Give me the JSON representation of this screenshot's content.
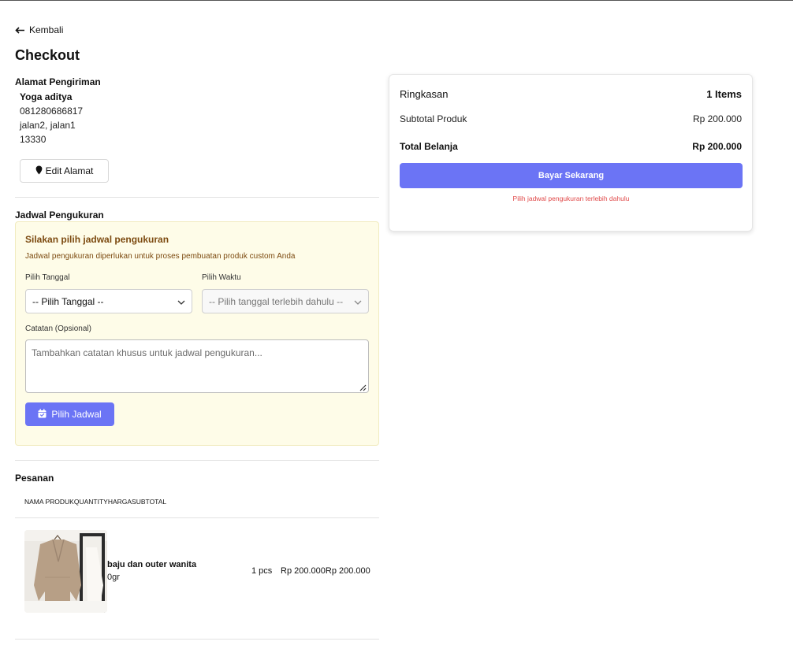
{
  "nav": {
    "back_label": "Kembali",
    "page_title": "Checkout"
  },
  "address": {
    "section_label": "Alamat Pengiriman",
    "name": "Yoga aditya",
    "phone": "081280686817",
    "street": "jalan2, jalan1",
    "postal_code": "13330",
    "edit_label": "Edit Alamat"
  },
  "schedule": {
    "section_label": "Jadwal Pengukuran",
    "heading": "Silakan pilih jadwal pengukuran",
    "description": "Jadwal pengukuran diperlukan untuk proses pembuatan produk custom Anda",
    "date_label": "Pilih Tanggal",
    "date_value": "-- Pilih Tanggal --",
    "time_label": "Pilih Waktu",
    "time_value": "-- Pilih tanggal terlebih dahulu --",
    "notes_label": "Catatan (Opsional)",
    "notes_placeholder": "Tambahkan catatan khusus untuk jadwal pengukuran...",
    "submit_label": "Pilih Jadwal"
  },
  "orders": {
    "section_label": "Pesanan",
    "columns": [
      "NAMA PRODUK",
      "QUANTITY",
      "HARGA",
      "SUBTOTAL"
    ],
    "items": [
      {
        "name": "baju dan outer wanita",
        "weight": "0gr",
        "quantity": "1 pcs",
        "price": "Rp 200.000",
        "subtotal": "Rp 200.000"
      }
    ]
  },
  "summary": {
    "title": "Ringkasan",
    "items_count": "1 Items",
    "subtotal_label": "Subtotal Produk",
    "subtotal_value": "Rp 200.000",
    "total_label": "Total Belanja",
    "total_value": "Rp 200.000",
    "pay_label": "Bayar Sekarang",
    "warning": "Pilih jadwal pengukuran terlebih dahulu"
  },
  "colors": {
    "accent": "#6b74f5",
    "schedule_bg": "#fefce8",
    "schedule_text": "#7c4a10",
    "warning": "#e04848"
  },
  "icons": [
    "arrow-left-icon",
    "map-pin-icon",
    "chevron-down-icon",
    "calendar-check-icon",
    "resize-grip-icon"
  ]
}
